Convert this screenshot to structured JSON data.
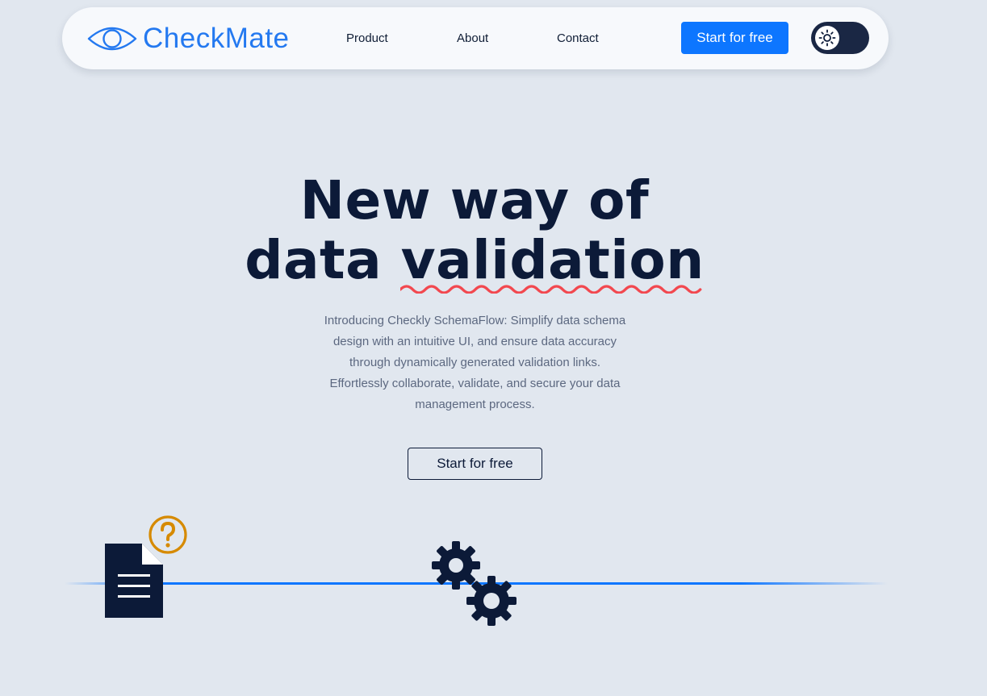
{
  "brand": {
    "name": "CheckMate",
    "logo_icon": "eye-icon",
    "color": "#2479f0"
  },
  "nav": {
    "links": [
      "Product",
      "About",
      "Contact"
    ],
    "cta_label": "Start for free",
    "cta_color": "#0d76ff",
    "theme_toggle_icon": "sun-icon"
  },
  "hero": {
    "title_line1": "New way of",
    "title_line2_plain": "data",
    "title_line2_underlined": "validation",
    "description": "Introducing Checkly SchemaFlow: Simplify data schema design with an intuitive UI, and ensure data accuracy through dynamically generated validation links. Effortlessly collaborate, validate, and secure your data management process.",
    "cta_label": "Start for free"
  },
  "illustration": {
    "icons": [
      "document-icon",
      "question-mark-icon",
      "gear-icon",
      "gear-icon"
    ],
    "accent_color": "#d68a00",
    "line_color": "#0d76ff",
    "squiggle_color": "#f2484f"
  },
  "colors": {
    "background": "#e1e7ef",
    "navbar_bg": "#f7f9fc",
    "heading": "#0c1a38"
  }
}
